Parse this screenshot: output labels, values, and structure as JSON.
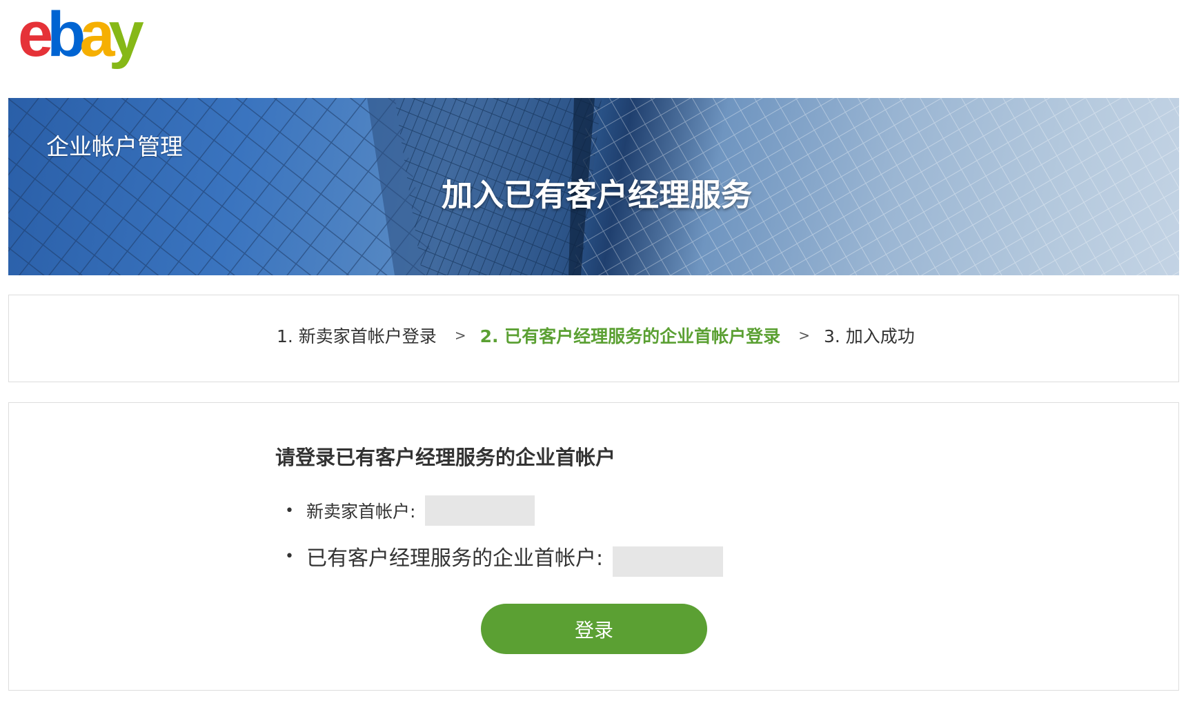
{
  "logo": {
    "letters": [
      {
        "char": "e",
        "color": "#e53238"
      },
      {
        "char": "b",
        "color": "#0064d2"
      },
      {
        "char": "a",
        "color": "#f5af02"
      },
      {
        "char": "y",
        "color": "#86b817"
      }
    ]
  },
  "banner": {
    "subtitle": "企业帐户管理",
    "title": "加入已有客户经理服务"
  },
  "steps": {
    "step1": "1. 新卖家首帐户登录",
    "sep1": ">",
    "step2": "2. 已有客户经理服务的企业首帐户登录",
    "sep2": ">",
    "step3": "3. 加入成功",
    "active_color": "#5ba033"
  },
  "login": {
    "heading": "请登录已有客户经理服务的企业首帐户",
    "bullet": "•",
    "new_seller_label": "新卖家首帐户:",
    "existing_label": "已有客户经理服务的企业首帐户:",
    "button_label": "登录",
    "button_color": "#5ba033"
  }
}
